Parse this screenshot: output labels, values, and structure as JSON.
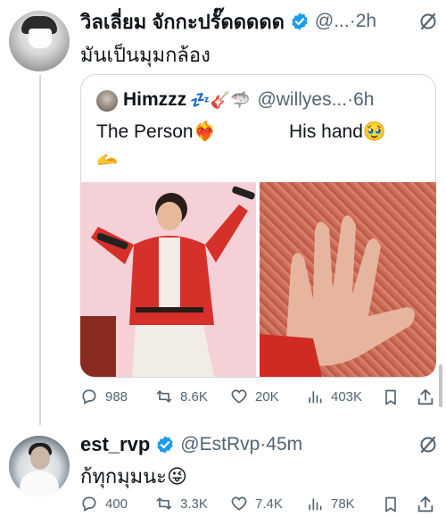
{
  "tweet1": {
    "name": "วิลเลี่ยม จักกะปรั๊ดดดดด",
    "handle": "@...",
    "time": "·2h",
    "text": "มันเป็นมุมกล้อง",
    "quote": {
      "name": "Himzzz",
      "name_emojis": "💤🎸🦈",
      "handle": "@willyes...",
      "time": "·6h",
      "text_left": "The Person❤️‍🔥",
      "text_left_2": "🫴",
      "text_right": "His hand🥹"
    },
    "stats": {
      "replies": "988",
      "reposts": "8.6K",
      "likes": "20K",
      "views": "403K"
    }
  },
  "tweet2": {
    "name": "est_rvp",
    "handle": "@EstRvp",
    "time": "·45m",
    "text": "ก้ทุกมุมนะ😜",
    "stats": {
      "replies": "400",
      "reposts": "3.3K",
      "likes": "7.4K",
      "views": "78K"
    }
  },
  "colors": {
    "verified": "#1d9bf0",
    "muted": "#536471",
    "border": "#cfd9de"
  }
}
